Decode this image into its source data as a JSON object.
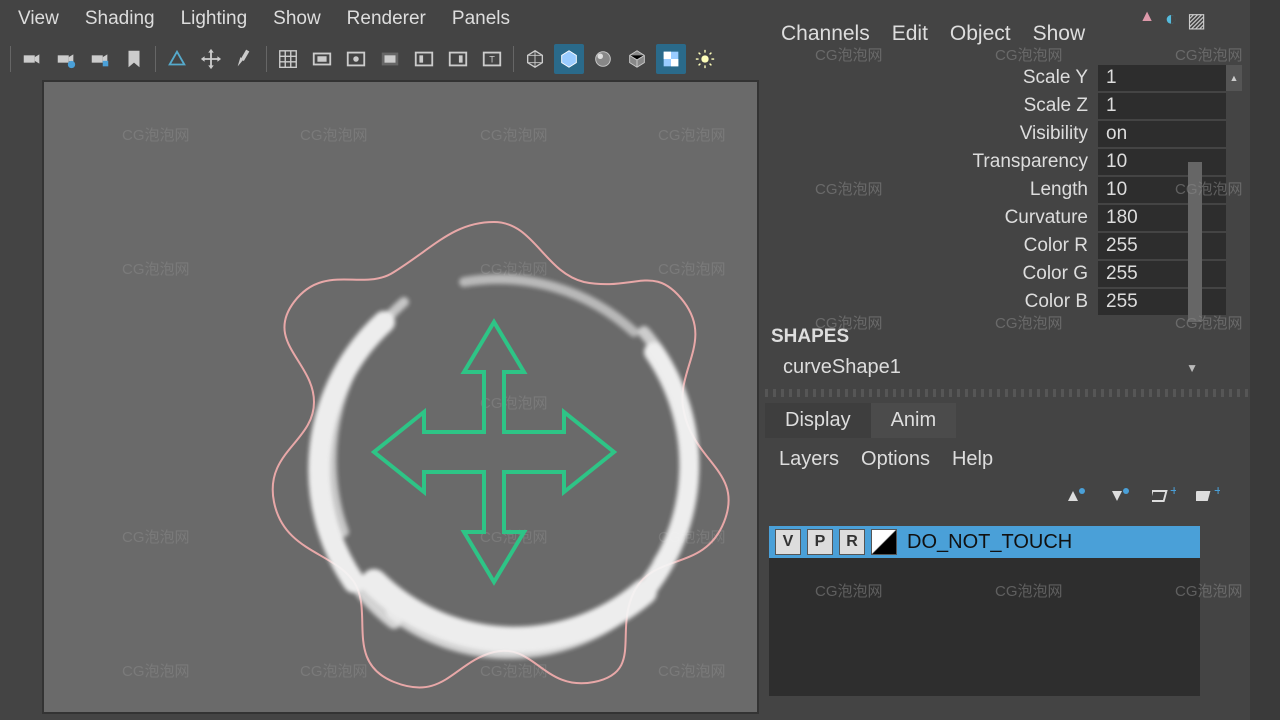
{
  "viewport_menu": {
    "view": "View",
    "shading": "Shading",
    "lighting": "Lighting",
    "show": "Show",
    "renderer": "Renderer",
    "panels": "Panels"
  },
  "right_menu": {
    "channels": "Channels",
    "edit": "Edit",
    "object": "Object",
    "show": "Show"
  },
  "attrs": {
    "scale_y": {
      "label": "Scale Y",
      "value": "1"
    },
    "scale_z": {
      "label": "Scale Z",
      "value": "1"
    },
    "visibility": {
      "label": "Visibility",
      "value": "on"
    },
    "transparency": {
      "label": "Transparency",
      "value": "10"
    },
    "length": {
      "label": "Length",
      "value": "10"
    },
    "curvature": {
      "label": "Curvature",
      "value": "180"
    },
    "color_r": {
      "label": "Color R",
      "value": "255"
    },
    "color_g": {
      "label": "Color G",
      "value": "255"
    },
    "color_b": {
      "label": "Color B",
      "value": "255"
    }
  },
  "shapes": {
    "header": "SHAPES",
    "name": "curveShape1"
  },
  "tabs": {
    "display": "Display",
    "anim": "Anim"
  },
  "layer_menu": {
    "layers": "Layers",
    "options": "Options",
    "help": "Help"
  },
  "layer": {
    "v": "V",
    "p": "P",
    "r": "R",
    "name": "DO_NOT_TOUCH"
  },
  "watermark_text": "CG泡泡网"
}
